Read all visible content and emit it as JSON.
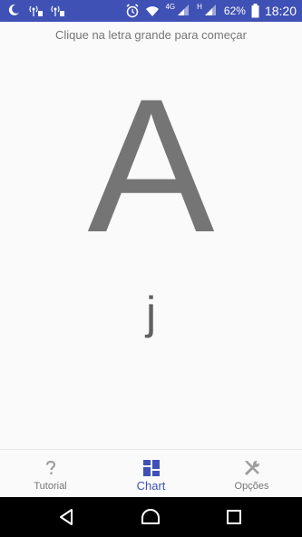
{
  "status_bar": {
    "time": "18:20",
    "battery": "62%",
    "network_4g": "4G",
    "network_h": "H",
    "icons": [
      "moon-icon",
      "signal-icon",
      "signal-icon",
      "alarm-icon",
      "wifi-icon",
      "cell-signal-icon",
      "cell-signal-icon",
      "battery-icon"
    ]
  },
  "main": {
    "hint": "Clique na letra grande para começar",
    "big_letter": "A",
    "small_letter": "j"
  },
  "bottom_nav": {
    "items": [
      {
        "label": "Tutorial",
        "icon": "question-icon"
      },
      {
        "label": "Chart",
        "icon": "grid-icon",
        "active": true
      },
      {
        "label": "Opções",
        "icon": "tools-icon"
      }
    ]
  },
  "colors": {
    "accent": "#3f51b5",
    "text_gray": "#757575"
  }
}
